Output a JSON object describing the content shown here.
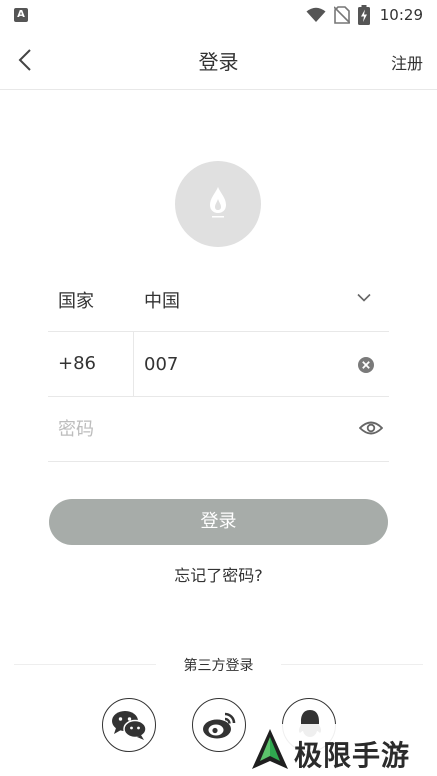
{
  "status_bar": {
    "app_icon_letter": "A",
    "time": "10:29",
    "icons": [
      "wifi-icon",
      "no-sim-icon",
      "battery-charging-icon"
    ]
  },
  "header": {
    "back_icon": "chevron-left-icon",
    "title": "登录",
    "register_label": "注册"
  },
  "avatar": {
    "icon": "flame-logo-icon"
  },
  "form": {
    "country_label": "国家",
    "country_value": "中国",
    "country_dropdown_icon": "chevron-down-icon",
    "phone_code": "+86",
    "phone_value": "007",
    "clear_icon": "clear-circle-icon",
    "password_placeholder": "密码",
    "password_visibility_icon": "eye-icon"
  },
  "login_button_label": "登录",
  "forgot_password_label": "忘记了密码?",
  "third_party": {
    "label": "第三方登录",
    "providers": [
      "wechat-icon",
      "weibo-icon",
      "qq-icon"
    ]
  },
  "watermark": {
    "text": "极限手游网"
  },
  "colors": {
    "login_button": "#a7aca9",
    "divider": "#e8e8e8",
    "avatar_bg": "#e0e0e0",
    "text": "#333333",
    "placeholder": "#bdbdbd"
  }
}
